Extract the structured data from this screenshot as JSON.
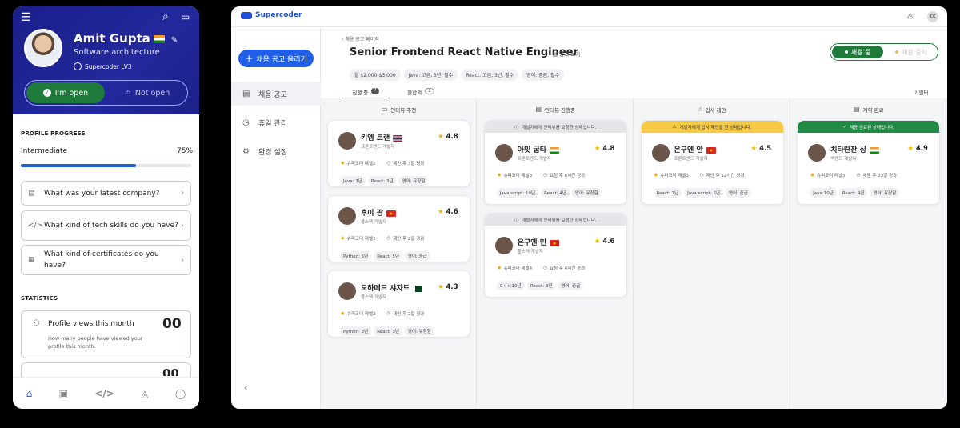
{
  "mobile": {
    "name": "Amit Gupta",
    "role": "Software architecture",
    "level": "Supercoder LV3",
    "toggle": {
      "open": "I'm open",
      "not_open": "Not open"
    },
    "progress": {
      "heading": "PROFILE PROGRESS",
      "level": "Intermediate",
      "percent": "75%",
      "value": 0.75
    },
    "questions": [
      "What was your latest company?",
      "What kind of tech skills do you have?",
      "What kind of certificates do you have?"
    ],
    "statistics": {
      "heading": "STATISTICS",
      "card_title": "Profile views this month",
      "card_value": "00",
      "card_desc": "How many people have viewed your profile this month.",
      "next_value": "00"
    }
  },
  "desktop": {
    "brand": "Supercoder",
    "avatar_initials": "CK",
    "sidebar": {
      "post_button": "채용 공고 올리기",
      "items": [
        "채용 공고",
        "휴일 관리",
        "환경 설정"
      ]
    },
    "header": {
      "breadcrumb": "채용 공고 페이지",
      "title": "Senior Frontend React Native Engineer",
      "view_post": "공고 보기",
      "chips": [
        "월 $2,000-$3,000",
        "Java: 고급, 3년, 필수",
        "React: 고급, 3년, 필수",
        "영어: 중급, 필수"
      ],
      "status_on": "채용 중",
      "status_off": "채용 중지"
    },
    "tabs": [
      {
        "label": "진행 중",
        "count": "7"
      },
      {
        "label": "불합격",
        "count": "2"
      }
    ],
    "filter": "필터",
    "columns": [
      {
        "title": "인터뷰 추천",
        "cards": [
          {
            "name": "키엠 트랜",
            "flag": "thailand",
            "rating": "4.8",
            "role": "프론트엔드 개발자",
            "level": "슈퍼코더 레벨2",
            "time": "제안 후 3일 경과",
            "tags": [
              "Java: 3년",
              "React: 3년",
              "영어: 유창함"
            ]
          },
          {
            "name": "후이 팜",
            "flag": "vietnam",
            "rating": "4.6",
            "role": "풀스택 개발자",
            "level": "슈퍼코더 레벨3",
            "time": "제안 후 2일 경과",
            "tags": [
              "Python: 5년",
              "React: 5년",
              "영어: 중급"
            ]
          },
          {
            "name": "모하메드 샤자드",
            "flag": "pakistan",
            "rating": "4.3",
            "role": "풀스택 개발자",
            "level": "슈퍼코더 레벨2",
            "time": "제안 후 2일 경과",
            "tags": [
              "Python: 3년",
              "React: 3년",
              "영어: 유창함"
            ]
          }
        ]
      },
      {
        "title": "인터뷰 진행중",
        "cards": [
          {
            "banner": "개발자에게 인터뷰를 요청한 상태입니다.",
            "name": "아밋 굽타",
            "flag": "india",
            "rating": "4.8",
            "role": "프론트엔드 개발자",
            "level": "슈퍼코더 레벨3",
            "time": "요청 후 6시간 경과",
            "tags": [
              "Java script: 10년",
              "React: 4년",
              "영어: 유창함"
            ]
          },
          {
            "banner": "개발자에게 인터뷰를 요청한 상태입니다.",
            "name": "은구엔 민",
            "flag": "vietnam",
            "rating": "4.6",
            "role": "풀스택 개발자",
            "level": "슈퍼코더 레벨4",
            "time": "요청 후 4시간 경과",
            "tags": [
              "C++:10년",
              "React: 8년",
              "영어: 중급"
            ]
          }
        ]
      },
      {
        "title": "입사 제안",
        "cards": [
          {
            "banner": "개발자에게 입사 제안을 한 상태입니다.",
            "name": "은구엔 안",
            "flag": "vietnam",
            "rating": "4.5",
            "role": "프론트엔드 개발자",
            "level": "슈퍼코더 레벨3",
            "time": "제안 후 12시간 경과",
            "tags": [
              "React: 7년",
              "Java script: 6년",
              "영어: 중급"
            ]
          }
        ]
      },
      {
        "title": "계약 완료",
        "cards": [
          {
            "banner": "채용 완료된 상태입니다.",
            "name": "치타란잔 싱",
            "flag": "india",
            "rating": "4.9",
            "role": "백엔드 개발자",
            "level": "슈퍼코더 레벨5",
            "time": "채용 후 23일 경과",
            "tags": [
              "Java:10년",
              "React: 4년",
              "영어: 유창함"
            ]
          }
        ]
      }
    ]
  },
  "colors": {
    "primary": "#1f5fe8",
    "open_green": "#1e7a3b",
    "offer_yellow": "#f6c945",
    "hired_green": "#1e8a44",
    "header_navy": "#1a1f8a"
  }
}
